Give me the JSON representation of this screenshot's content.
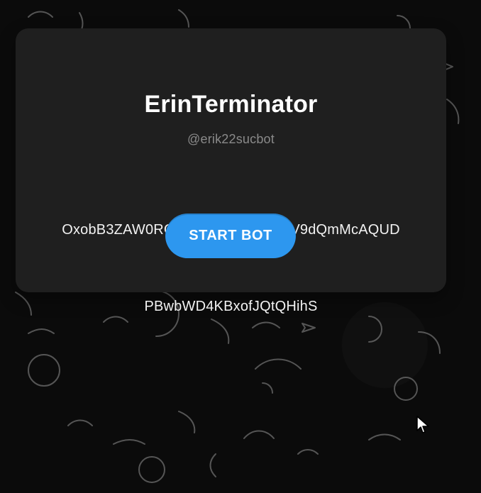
{
  "card": {
    "title": "ErinTerminator",
    "handle": "@erik22sucbot",
    "description_line1": "OxobB3ZAW0RGYkBdQ39BRUVKfV9dQmMcAQUD",
    "description_line2": "PBwbWD4KBxofJQtQHihS",
    "button_label": "START BOT"
  },
  "colors": {
    "background": "#0b0b0b",
    "card": "#1f1f1f",
    "accent": "#2d97ef",
    "title": "#ffffff",
    "muted": "#8a8a8a"
  },
  "icons": {
    "cursor": "mouse-pointer-icon",
    "background": "doodle-pattern"
  }
}
